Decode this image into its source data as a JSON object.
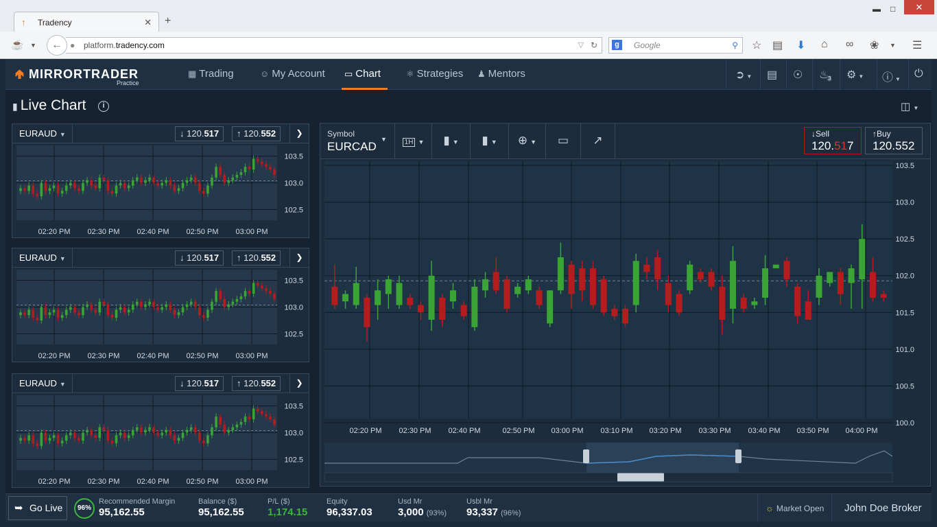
{
  "browser": {
    "tab_title": "Tradency",
    "url_prefix": "platform.",
    "url_domain": "tradency.com",
    "url_suffix": ".com",
    "search_placeholder": "Google"
  },
  "app": {
    "logo_text": "MIRRORTRADER",
    "logo_sub": "Practice",
    "nav": [
      {
        "label": "Trading",
        "icon": "trading-grid-icon"
      },
      {
        "label": "My Account",
        "icon": "user-icon"
      },
      {
        "label": "Chart",
        "icon": "bar-chart-icon",
        "active": true
      },
      {
        "label": "Strategies",
        "icon": "strategy-icon"
      },
      {
        "label": "Mentors",
        "icon": "mentor-icon"
      }
    ],
    "notification_count": "3"
  },
  "page": {
    "title": "Live Chart"
  },
  "mini_charts": [
    {
      "symbol": "EURAUD",
      "sell": {
        "base": "120.",
        "pips": "517"
      },
      "buy": {
        "base": "120.",
        "pips": "552"
      }
    },
    {
      "symbol": "EURAUD",
      "sell": {
        "base": "120.",
        "pips": "517"
      },
      "buy": {
        "base": "120.",
        "pips": "552"
      }
    },
    {
      "symbol": "EURAUD",
      "sell": {
        "base": "120.",
        "pips": "517"
      },
      "buy": {
        "base": "120.",
        "pips": "552"
      }
    }
  ],
  "mini_axis": {
    "y_ticks": [
      "103.5",
      "103.0",
      "102.5"
    ],
    "x_ticks": [
      "02:20 PM",
      "02:30 PM",
      "02:40 PM",
      "02:50 PM",
      "03:00 PM"
    ]
  },
  "main_chart": {
    "symbol_label": "Symbol",
    "symbol": "EURCAD",
    "timeframe": "1H",
    "sell": {
      "label": "Sell",
      "base": "120.",
      "hl": "51",
      "tail": "7"
    },
    "buy": {
      "label": "Buy",
      "base": "120.",
      "hl": "55",
      "tail": "2"
    }
  },
  "chart_data": {
    "type": "candlestick",
    "title": "",
    "xlabel": "",
    "ylabel": "",
    "ylim": [
      100.0,
      103.5
    ],
    "y_ticks": [
      "103.5",
      "103.0",
      "102.5",
      "102.0",
      "101.5",
      "101.0",
      "100.5",
      "100.0"
    ],
    "x_ticks": [
      "02:20 PM",
      "02:30 PM",
      "02:40 PM",
      "02:50 PM",
      "03:00 PM",
      "03:10 PM",
      "03:20 PM",
      "03:30 PM",
      "03:40 PM",
      "03:50 PM",
      "04:00 PM"
    ],
    "ref_line": 101.93,
    "candles": [
      [
        101.85,
        101.6,
        102.15,
        101.55
      ],
      [
        101.65,
        101.75,
        101.8,
        101.55
      ],
      [
        101.6,
        101.9,
        102.12,
        101.55
      ],
      [
        101.7,
        101.3,
        101.75,
        101.1
      ],
      [
        101.6,
        101.8,
        101.95,
        101.4
      ],
      [
        101.75,
        101.95,
        102.0,
        101.55
      ],
      [
        101.6,
        101.9,
        102.0,
        101.55
      ],
      [
        101.7,
        101.6,
        101.75,
        101.55
      ],
      [
        101.6,
        101.5,
        101.65,
        101.4
      ],
      [
        101.4,
        102.0,
        102.2,
        101.25
      ],
      [
        101.7,
        101.4,
        101.75,
        101.3
      ],
      [
        101.65,
        101.8,
        101.9,
        101.55
      ],
      [
        101.6,
        101.45,
        101.65,
        101.4
      ],
      [
        101.3,
        101.85,
        101.95,
        101.25
      ],
      [
        101.8,
        101.95,
        102.05,
        101.7
      ],
      [
        102.05,
        101.8,
        102.25,
        101.75
      ],
      [
        101.95,
        101.55,
        102.0,
        101.5
      ],
      [
        101.75,
        101.85,
        101.9,
        101.7
      ],
      [
        101.8,
        101.95,
        102.0,
        101.75
      ],
      [
        101.8,
        101.6,
        101.85,
        101.55
      ],
      [
        101.35,
        101.8,
        101.8,
        101.3
      ],
      [
        101.8,
        102.25,
        102.45,
        101.75
      ],
      [
        102.15,
        101.75,
        102.2,
        101.55
      ],
      [
        102.1,
        101.8,
        102.2,
        101.65
      ],
      [
        102.1,
        101.6,
        102.2,
        101.55
      ],
      [
        101.95,
        101.5,
        102.0,
        101.45
      ],
      [
        101.55,
        101.45,
        101.6,
        101.4
      ],
      [
        101.55,
        101.35,
        101.6,
        101.3
      ],
      [
        101.6,
        102.2,
        102.3,
        101.5
      ],
      [
        102.15,
        102.05,
        102.25,
        101.95
      ],
      [
        102.25,
        101.95,
        102.35,
        101.8
      ],
      [
        101.9,
        101.6,
        102.0,
        101.5
      ],
      [
        101.75,
        101.5,
        101.8,
        101.45
      ],
      [
        101.8,
        102.15,
        102.2,
        101.75
      ],
      [
        102.05,
        101.95,
        102.1,
        101.9
      ],
      [
        102.05,
        101.85,
        102.1,
        101.8
      ],
      [
        101.85,
        101.4,
        102.0,
        101.2
      ],
      [
        101.55,
        102.2,
        102.4,
        101.35
      ],
      [
        101.7,
        101.55,
        101.75,
        101.5
      ],
      [
        101.6,
        101.65,
        101.7,
        101.55
      ],
      [
        101.7,
        102.1,
        102.28,
        101.6
      ],
      [
        102.1,
        102.15,
        102.15,
        102.1
      ],
      [
        102.2,
        101.95,
        102.25,
        101.85
      ],
      [
        101.85,
        101.45,
        101.9,
        101.35
      ],
      [
        101.65,
        101.4,
        101.8,
        101.4
      ],
      [
        101.7,
        102.0,
        102.1,
        101.6
      ],
      [
        101.9,
        102.05,
        102.05,
        101.85
      ],
      [
        102.05,
        101.75,
        102.1,
        101.6
      ],
      [
        101.9,
        102.1,
        102.15,
        101.55
      ],
      [
        101.95,
        102.5,
        102.7,
        101.55
      ],
      [
        102.05,
        101.7,
        102.25,
        101.65
      ],
      [
        101.75,
        101.7,
        101.8,
        101.65
      ]
    ]
  },
  "mini_chart_data": {
    "type": "candlestick",
    "ylim": [
      102.3,
      103.7
    ],
    "ref_line": 103.0,
    "closes": [
      102.9,
      102.85,
      102.95,
      102.8,
      102.75,
      103.0,
      102.85,
      102.9,
      102.95,
      102.8,
      102.85,
      102.95,
      103.0,
      102.9,
      102.85,
      103.0,
      103.05,
      102.95,
      102.9,
      103.1,
      103.05,
      102.85,
      102.8,
      102.95,
      103.0,
      102.9,
      102.95,
      103.05,
      103.1,
      103.0,
      103.05,
      103.1,
      103.0,
      102.95,
      103.0,
      103.05,
      102.95,
      102.85,
      102.9,
      103.0,
      103.05,
      103.1,
      103.0,
      102.85,
      102.8,
      102.95,
      103.1,
      103.3,
      103.15,
      103.0,
      103.05,
      103.1,
      103.15,
      103.2,
      103.3,
      103.25,
      103.45,
      103.4,
      103.35,
      103.3,
      103.25,
      103.15
    ]
  },
  "bottom_bar": {
    "go_live": "Go Live",
    "ring_pct": "96%",
    "stats": [
      {
        "label": "Recommended Margin",
        "value": "95,162.55",
        "sub": ""
      },
      {
        "label": "Balance ($)",
        "value": "95,162.55",
        "sub": ""
      },
      {
        "label": "P/L ($)",
        "value": "1,174.15",
        "sub": ""
      },
      {
        "label": "Equity",
        "value": "96,337.03",
        "sub": ""
      },
      {
        "label": "Usd Mr",
        "value": "3,000",
        "sub": "(93%)"
      },
      {
        "label": "Usbl Mr",
        "value": "93,337",
        "sub": "(96%)"
      }
    ],
    "market_status": "Market Open",
    "user": "John Doe Broker"
  },
  "colors": {
    "bull": "#3aa535",
    "bear": "#b51c1e",
    "accent": "#f07d21",
    "grid": "#0f1923"
  }
}
